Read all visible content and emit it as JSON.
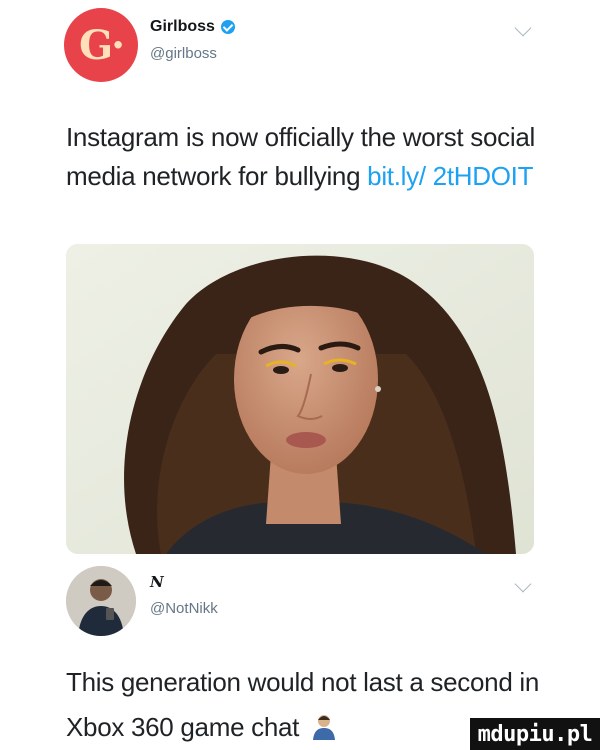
{
  "tweet1": {
    "author_name": "Girlboss",
    "author_handle": "@girlboss",
    "avatar_text": "G·",
    "text_main": "Instagram is now officially the worst social media network for bullying ",
    "text_link": "bit.ly/ 2tHDOIT",
    "photo_icon": "portrait-photo"
  },
  "tweet2": {
    "author_name": "N",
    "author_handle": "@NotNikk",
    "text": "This generation would not last a second in Xbox 360 game chat",
    "emoji_icon": "person-emoji"
  },
  "watermark": "mdupiu.pl",
  "colors": {
    "accent": "#1da1f2",
    "brand_avatar": "#e8424a",
    "text": "#14171a",
    "muted": "#657786"
  }
}
